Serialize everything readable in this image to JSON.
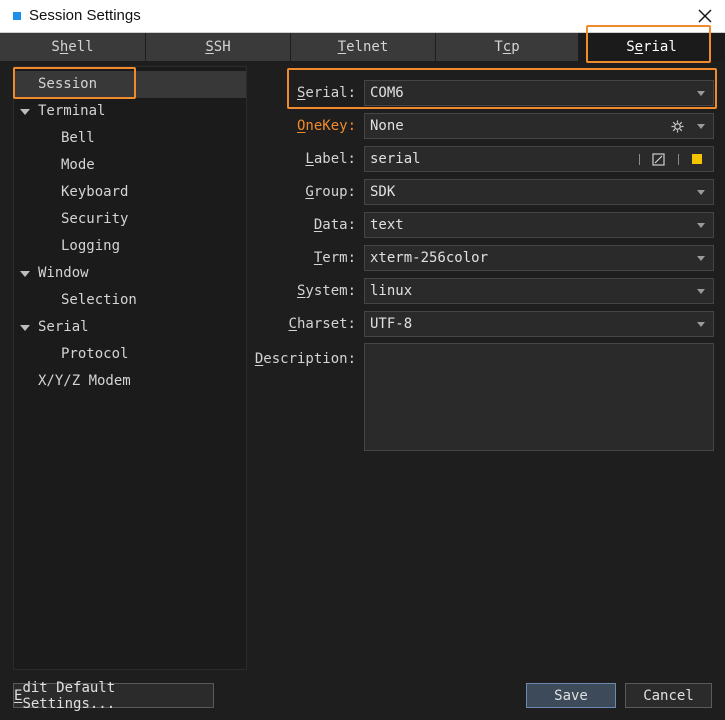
{
  "window": {
    "title": "Session Settings"
  },
  "tabs": [
    {
      "pre": "S",
      "ul": "h",
      "post": "ell"
    },
    {
      "pre": "",
      "ul": "S",
      "post": "SH"
    },
    {
      "pre": "",
      "ul": "T",
      "post": "elnet"
    },
    {
      "pre": "T",
      "ul": "c",
      "post": "p"
    },
    {
      "pre": "S",
      "ul": "e",
      "post": "rial"
    }
  ],
  "active_tab": "Serial",
  "sidebar": {
    "items": [
      {
        "label": "Session"
      },
      {
        "label": "Terminal"
      },
      {
        "label": "Bell"
      },
      {
        "label": "Mode"
      },
      {
        "label": "Keyboard"
      },
      {
        "label": "Security"
      },
      {
        "label": "Logging"
      },
      {
        "label": "Window"
      },
      {
        "label": "Selection"
      },
      {
        "label": "Serial"
      },
      {
        "label": "Protocol"
      },
      {
        "label": "X/Y/Z Modem"
      }
    ],
    "selected": "Session"
  },
  "form": {
    "serial": {
      "ul": "S",
      "rest": "erial:",
      "value": "COM6"
    },
    "onekey": {
      "ul": "O",
      "rest": "neKey:",
      "value": "None"
    },
    "label": {
      "ul": "L",
      "rest": "abel:",
      "value": "serial"
    },
    "group": {
      "ul": "G",
      "rest": "roup:",
      "value": "SDK"
    },
    "data": {
      "ul": "D",
      "rest": "ata:",
      "value": "text"
    },
    "term": {
      "ul": "T",
      "rest": "erm:",
      "value": "xterm-256color"
    },
    "system": {
      "ul": "S",
      "rest": "ystem:",
      "value": "linux"
    },
    "charset": {
      "ul": "C",
      "rest": "harset:",
      "value": "UTF-8"
    },
    "description": {
      "ul": "D",
      "rest": "escription:",
      "value": ""
    }
  },
  "buttons": {
    "edit_default": {
      "ul": "E",
      "rest": "dit Default Settings..."
    },
    "save": "Save",
    "cancel": "Cancel"
  },
  "colors": {
    "accent_orange": "#f08a2c",
    "label_color_swatch": "#f5c400",
    "title_icon": "#1e8fe8"
  },
  "icons": {
    "onekey": "gear-icon",
    "label_edit": "edit-square-icon",
    "label_color": "color-swatch-icon",
    "close": "close-icon"
  }
}
